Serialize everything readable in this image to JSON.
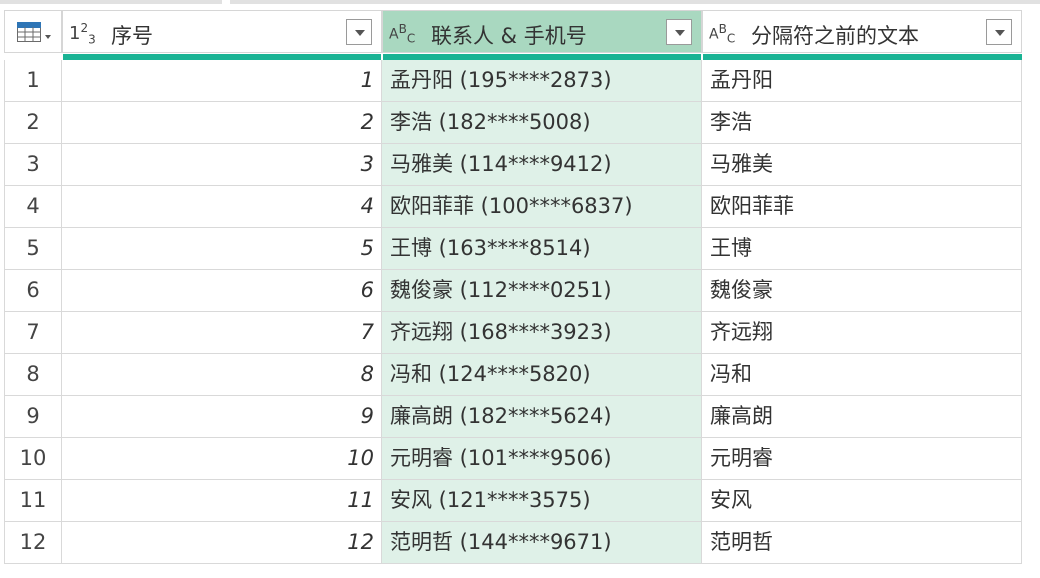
{
  "colors": {
    "accent": "#1ab394",
    "selected_header": "#a9d8c0",
    "selected_column": "#dff1e8",
    "grid_line": "#d9d9d9"
  },
  "header": {
    "table_menu_icon": "table-icon",
    "columns": [
      {
        "type_icon": "number-type-icon",
        "type_text": "123",
        "label": "序号"
      },
      {
        "type_icon": "text-type-icon",
        "type_text": "ABC",
        "label": "联系人 & 手机号"
      },
      {
        "type_icon": "text-type-icon",
        "type_text": "ABC",
        "label": "分隔符之前的文本"
      }
    ]
  },
  "rows": [
    {
      "index": "1",
      "seq": "1",
      "contact": "孟丹阳 (195****2873)",
      "before": "孟丹阳"
    },
    {
      "index": "2",
      "seq": "2",
      "contact": "李浩 (182****5008)",
      "before": "李浩"
    },
    {
      "index": "3",
      "seq": "3",
      "contact": "马雅美 (114****9412)",
      "before": "马雅美"
    },
    {
      "index": "4",
      "seq": "4",
      "contact": "欧阳菲菲 (100****6837)",
      "before": "欧阳菲菲"
    },
    {
      "index": "5",
      "seq": "5",
      "contact": "王博 (163****8514)",
      "before": "王博"
    },
    {
      "index": "6",
      "seq": "6",
      "contact": "魏俊豪 (112****0251)",
      "before": "魏俊豪"
    },
    {
      "index": "7",
      "seq": "7",
      "contact": "齐远翔 (168****3923)",
      "before": "齐远翔"
    },
    {
      "index": "8",
      "seq": "8",
      "contact": "冯和 (124****5820)",
      "before": "冯和"
    },
    {
      "index": "9",
      "seq": "9",
      "contact": "廉高朗 (182****5624)",
      "before": "廉高朗"
    },
    {
      "index": "10",
      "seq": "10",
      "contact": "元明睿 (101****9506)",
      "before": "元明睿"
    },
    {
      "index": "11",
      "seq": "11",
      "contact": "安风 (121****3575)",
      "before": "安风"
    },
    {
      "index": "12",
      "seq": "12",
      "contact": "范明哲 (144****9671)",
      "before": "范明哲"
    }
  ]
}
